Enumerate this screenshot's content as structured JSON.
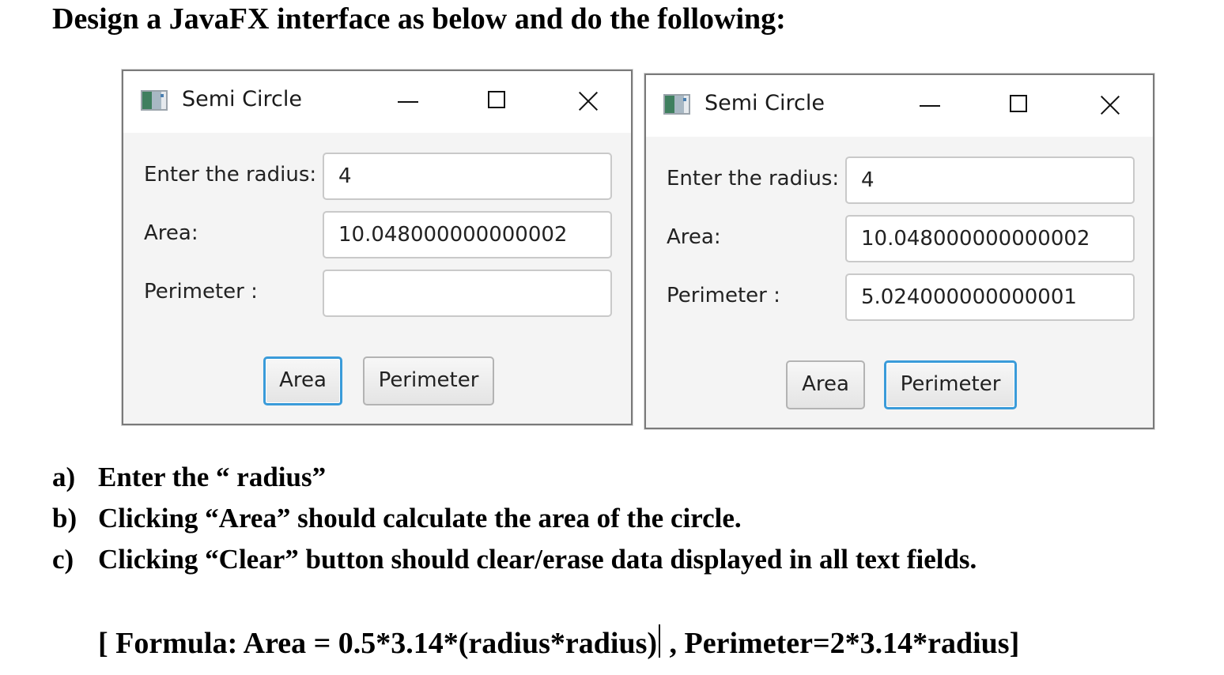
{
  "heading": "Design a JavaFX interface as below and do the following:",
  "windows": [
    {
      "title": "Semi Circle",
      "radius_label": "Enter the radius:",
      "radius_value": "4",
      "area_label": "Area:",
      "area_value": "10.048000000000002",
      "perimeter_label": "Perimeter :",
      "perimeter_value": "",
      "area_button": "Area",
      "perimeter_button": "Perimeter",
      "focused_button": "Area"
    },
    {
      "title": "Semi Circle",
      "radius_label": "Enter the radius:",
      "radius_value": "4",
      "area_label": "Area:",
      "area_value": "10.048000000000002",
      "perimeter_label": "Perimeter :",
      "perimeter_value": "5.024000000000001",
      "area_button": "Area",
      "perimeter_button": "Perimeter",
      "focused_button": "Perimeter"
    }
  ],
  "instructions": [
    {
      "marker": "a)",
      "text": "Enter the “ radius”"
    },
    {
      "marker": "b)",
      "text": "Clicking “Area” should calculate the area of the circle."
    },
    {
      "marker": "c)",
      "text": "Clicking “Clear” button should clear/erase data displayed in all text fields."
    }
  ],
  "formula": {
    "part1": "[ Formula: Area = 0.5*3.14*(radius*radius)",
    "part2": " ,  Perimeter=2*3.14*radius]"
  },
  "colors": {
    "focus_border": "#3a9bd9",
    "window_bg": "#f4f4f4",
    "titlebar_bg": "#ffffff"
  }
}
